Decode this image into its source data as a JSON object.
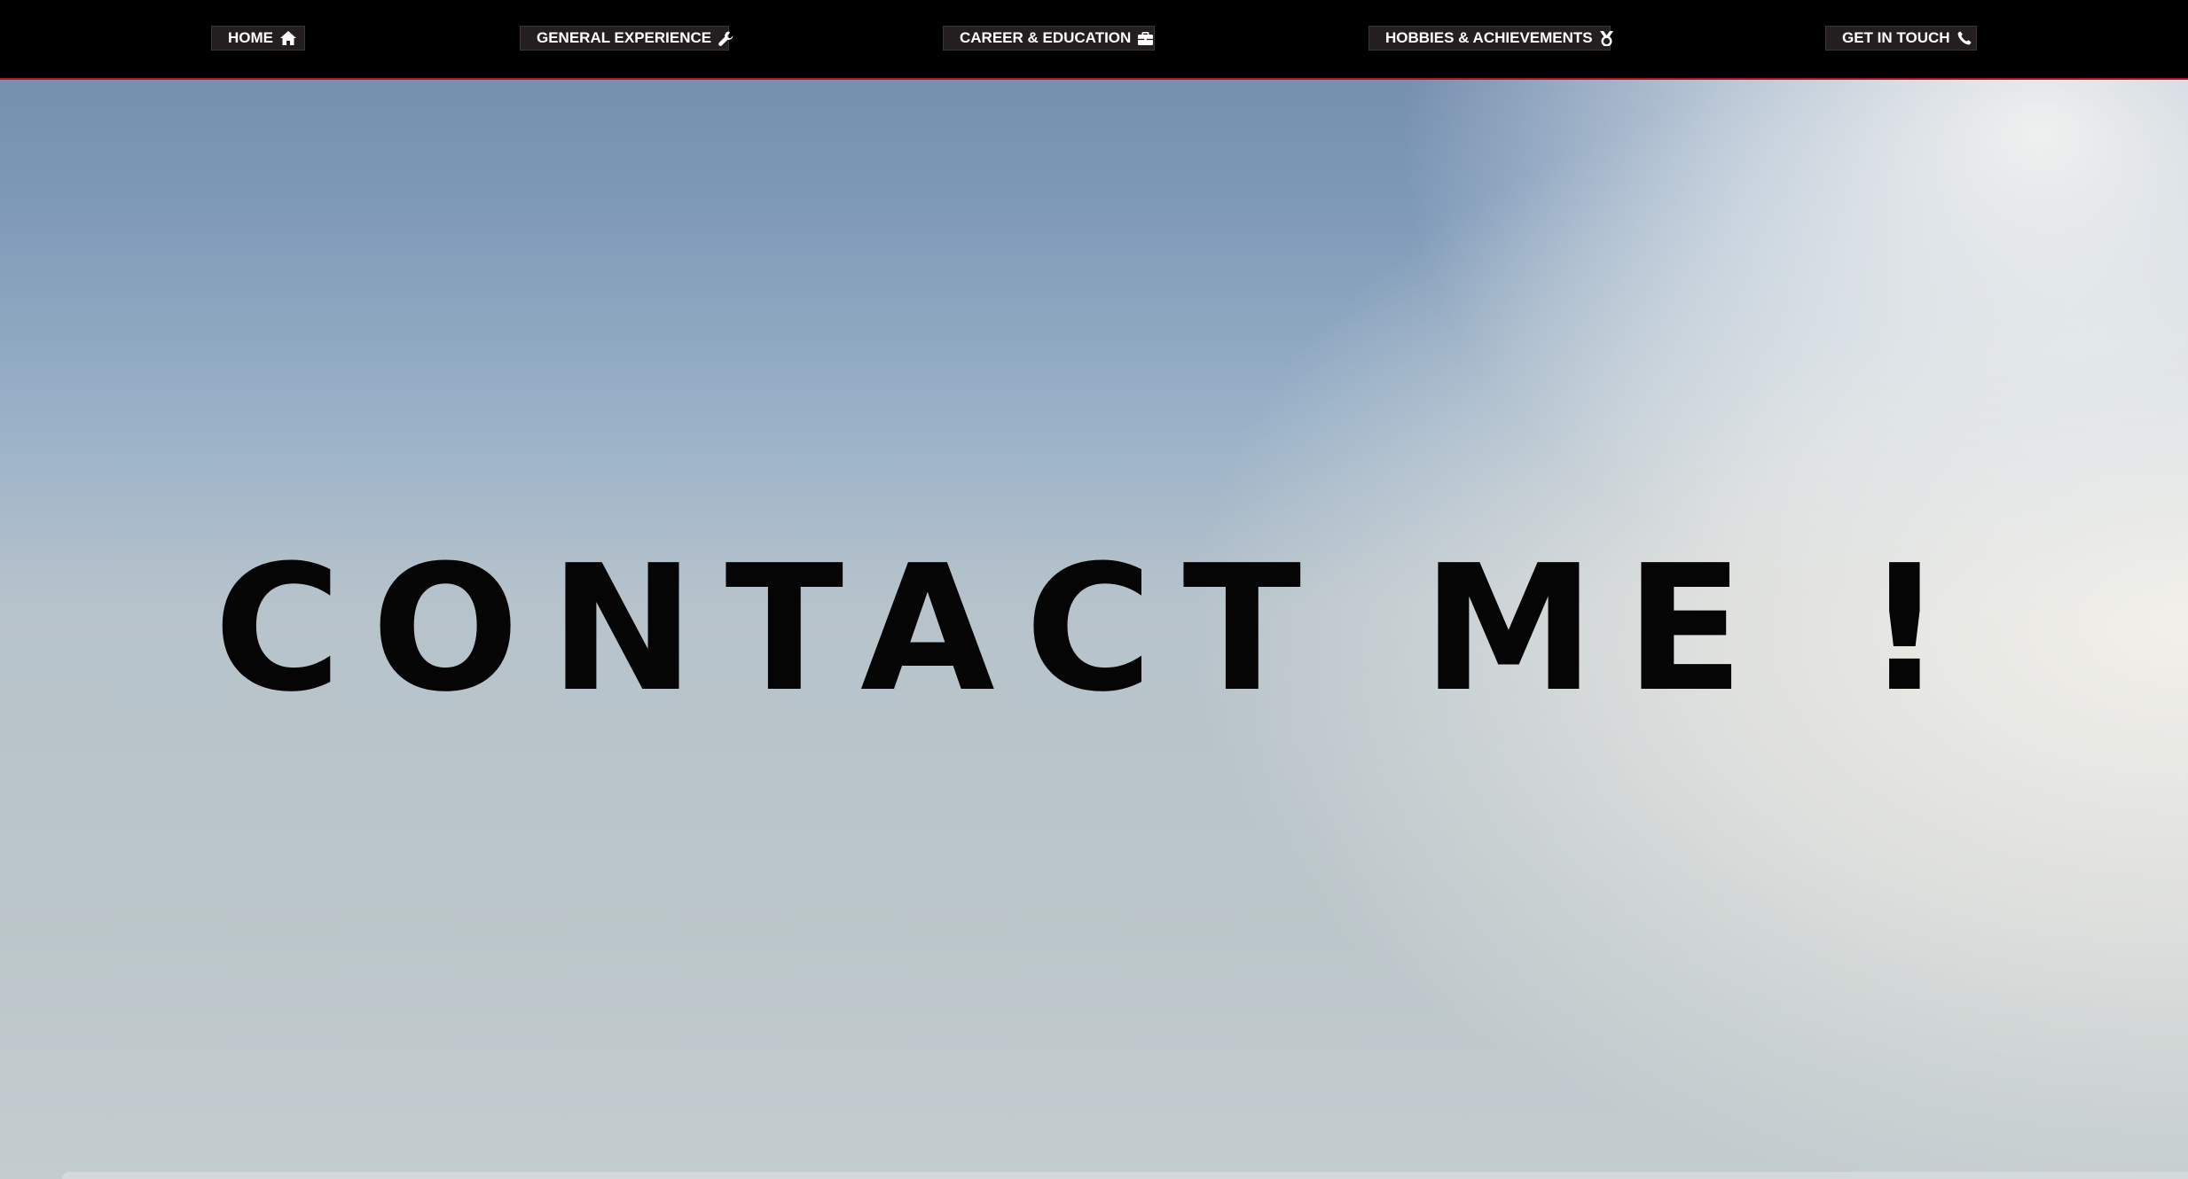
{
  "nav": {
    "items": [
      {
        "id": "home",
        "label": "HOME",
        "icon": "home-icon"
      },
      {
        "id": "general_experience",
        "label": "GENERAL EXPERIENCE",
        "icon": "wrench-icon"
      },
      {
        "id": "career_education",
        "label": "CAREER & EDUCATION",
        "icon": "briefcase-icon"
      },
      {
        "id": "hobbies_achievements",
        "label": "HOBBIES & ACHIEVEMENTS",
        "icon": "medal-icon"
      },
      {
        "id": "get_in_touch",
        "label": "GET IN TOUCH",
        "icon": "phone-icon"
      }
    ]
  },
  "hero": {
    "title": "CONTACT ME !"
  },
  "colors": {
    "nav_background": "#000000",
    "nav_button_background": "#231f20",
    "nav_accent_border": "#b3161f",
    "title_color": "#050505"
  }
}
